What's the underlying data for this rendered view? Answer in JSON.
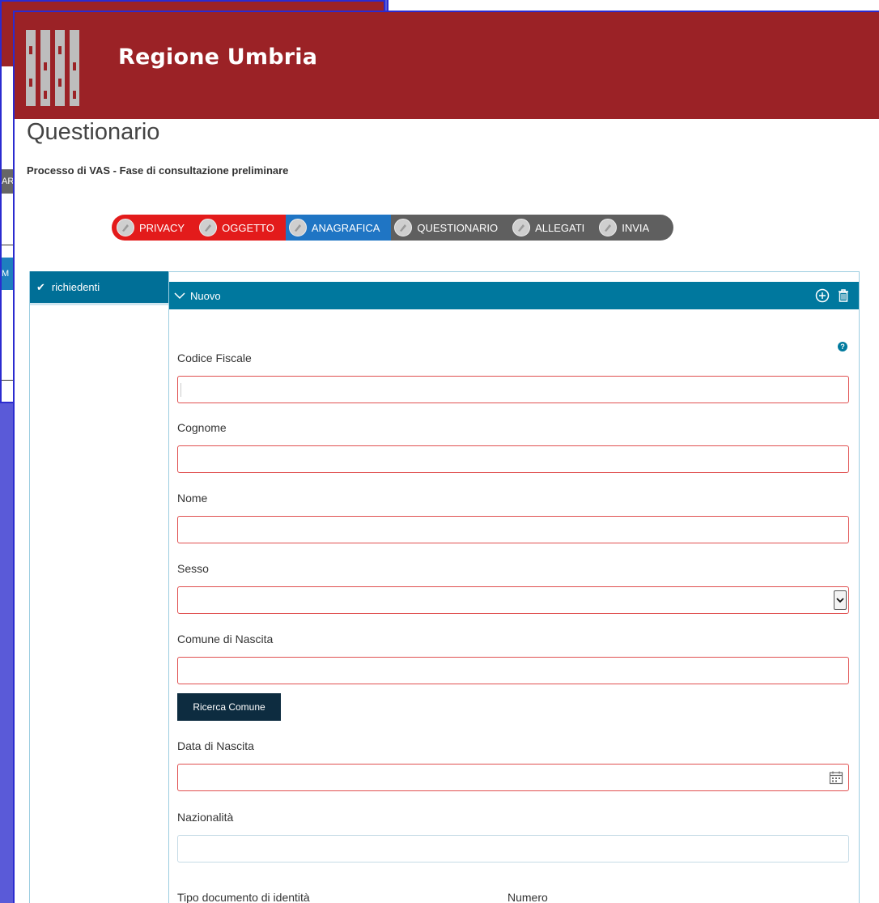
{
  "background": {
    "window_a": {
      "grey_tab_text": "AR",
      "blue_tab_text": "M"
    }
  },
  "header": {
    "brand": "Regione Umbria",
    "color": "#9b2226"
  },
  "page": {
    "title": "Questionario",
    "subtitle": "Processo di VAS - Fase di consultazione preliminare"
  },
  "steps": [
    {
      "label": "PRIVACY",
      "state": "done",
      "color": "#e31b1b"
    },
    {
      "label": "OGGETTO",
      "state": "done",
      "color": "#e31b1b"
    },
    {
      "label": "ANAGRAFICA",
      "state": "current",
      "color": "#1f75c4"
    },
    {
      "label": "QUESTIONARIO",
      "state": "todo",
      "color": "#5f5f5f"
    },
    {
      "label": "ALLEGATI",
      "state": "todo",
      "color": "#5f5f5f"
    },
    {
      "label": "INVIA",
      "state": "todo",
      "color": "#5f5f5f"
    }
  ],
  "sidebar": {
    "items": [
      {
        "label": "richiedenti",
        "icon": "check-icon"
      }
    ]
  },
  "section": {
    "title": "Nuovo",
    "icons": [
      "add-circle-icon",
      "trash-icon"
    ]
  },
  "form": {
    "codice_fiscale": {
      "label": "Codice Fiscale",
      "value": ""
    },
    "cognome": {
      "label": "Cognome",
      "value": ""
    },
    "nome": {
      "label": "Nome",
      "value": ""
    },
    "sesso": {
      "label": "Sesso",
      "value": ""
    },
    "comune_nascita": {
      "label": "Comune di Nascita",
      "value": ""
    },
    "ricerca_button": "Ricerca Comune",
    "data_nascita": {
      "label": "Data di Nascita",
      "value": ""
    },
    "nazionalita": {
      "label": "Nazionalità",
      "value": ""
    },
    "tipo_documento": {
      "label": "Tipo documento di identità"
    },
    "numero": {
      "label": "Numero"
    }
  }
}
